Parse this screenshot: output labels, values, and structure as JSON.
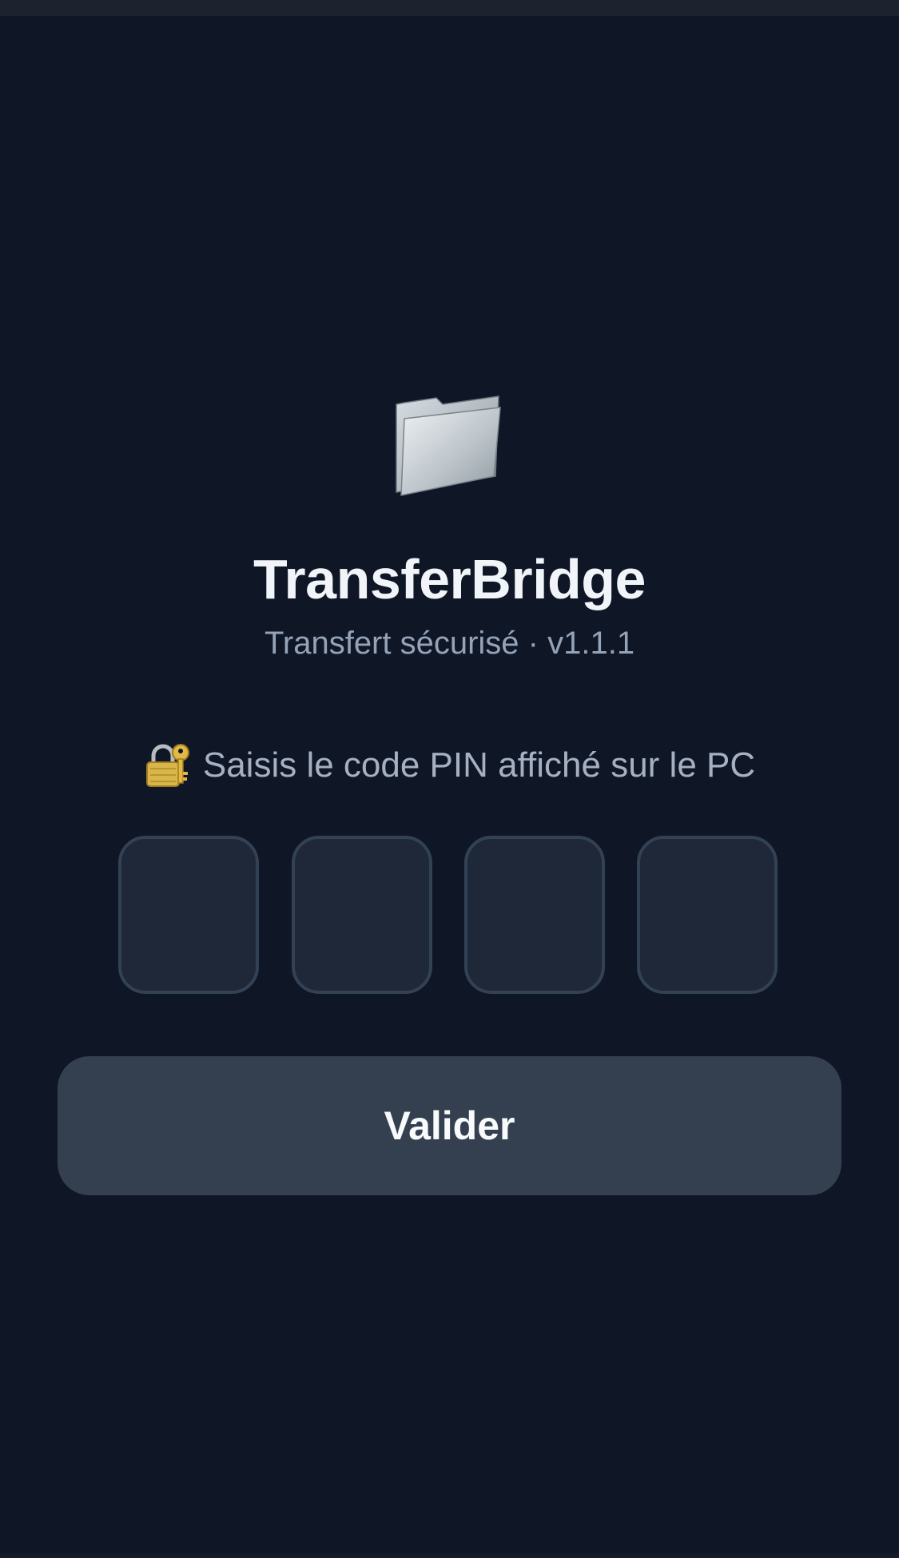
{
  "app": {
    "title": "TransferBridge",
    "subtitle": "Transfert sécurisé · v1.1.1",
    "logo_icon": "folder-icon"
  },
  "pin": {
    "prompt_icon": "lock-with-key-icon",
    "prompt": "Saisis le code PIN affiché sur le PC",
    "digits": [
      "",
      "",
      "",
      ""
    ]
  },
  "actions": {
    "validate_label": "Valider"
  },
  "colors": {
    "background": "#0f1626",
    "title": "#f1f5f9",
    "subtitle": "#94a3b8",
    "pin_box_fill": "#1e2838",
    "pin_box_border": "#334155",
    "button_fill": "#344050"
  }
}
